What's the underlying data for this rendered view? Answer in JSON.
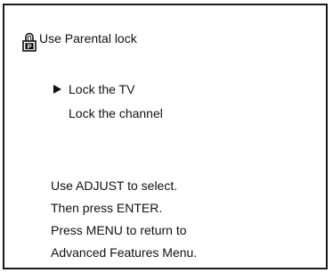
{
  "screen": {
    "title": "Use Parental lock",
    "title_icon": "padlock-p-icon",
    "menu_items": [
      {
        "label": "Lock the TV",
        "selected": true
      },
      {
        "label": "Lock the channel",
        "selected": false
      }
    ],
    "instructions": [
      "Use ADJUST to select.",
      "Then press ENTER.",
      "Press MENU to return to",
      "Advanced Features Menu."
    ]
  }
}
